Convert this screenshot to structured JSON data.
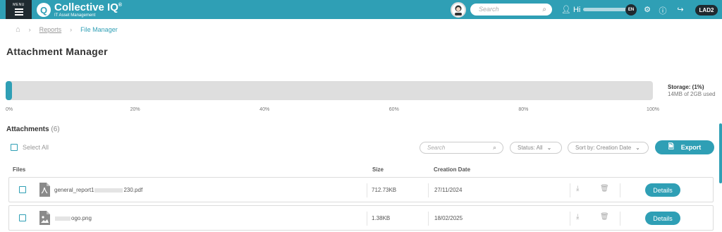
{
  "header": {
    "menu_label": "MENU",
    "logo_title": "Collective IQ",
    "logo_registered": "®",
    "logo_subtitle": "IT Asset Management",
    "search_placeholder": "Search",
    "greeting": "Hi",
    "language": "EN",
    "environment": "LAD2"
  },
  "breadcrumb": {
    "items": [
      "Reports",
      "File Manager"
    ]
  },
  "page_title": "Attachment Manager",
  "storage": {
    "percent_used": 1,
    "label": "Storage: (1%)",
    "usage_text": "14MB of 2GB used",
    "ticks": [
      "0%",
      "20%",
      "40%",
      "60%",
      "80%",
      "100%"
    ],
    "accent_color": "#2f9fb5"
  },
  "attachments": {
    "title": "Attachments",
    "count": "(6)",
    "select_all": "Select All",
    "search_placeholder": "Search",
    "status_filter": "Status: All",
    "sort_filter": "Sort by: Creation Date",
    "export_label": "Export",
    "columns": {
      "files": "Files",
      "size": "Size",
      "created": "Creation Date"
    },
    "rows": [
      {
        "name_start": "general_report1",
        "name_end": "230.pdf",
        "size": "712.73KB",
        "created": "27/11/2024",
        "action": "Details",
        "icon": "pdf-file-icon"
      },
      {
        "name_start": "",
        "name_end": "ogo.png",
        "size": "1.38KB",
        "created": "18/02/2025",
        "action": "Details",
        "icon": "image-file-icon"
      }
    ]
  }
}
